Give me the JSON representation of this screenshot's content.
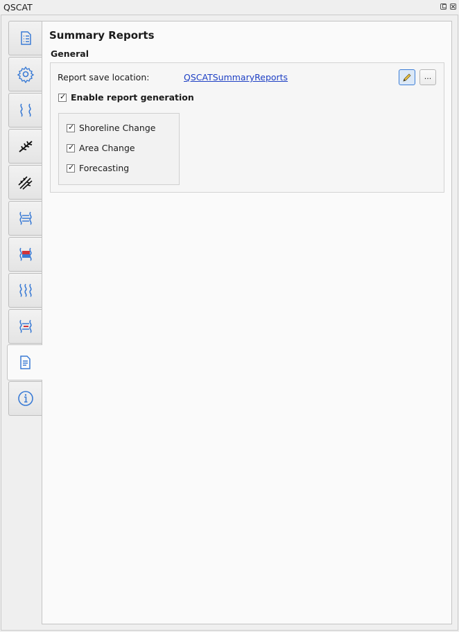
{
  "window": {
    "title": "QSCAT"
  },
  "tabs": [
    {
      "name": "project-settings",
      "icon": "list-document-icon"
    },
    {
      "name": "settings",
      "icon": "gear-icon"
    },
    {
      "name": "shorelines",
      "icon": "shoreline-lines-icon"
    },
    {
      "name": "transects",
      "icon": "transects-icon"
    },
    {
      "name": "intersections",
      "icon": "multi-transects-icon"
    },
    {
      "name": "shoreline-change",
      "icon": "shoreline-change-icon"
    },
    {
      "name": "area-change",
      "icon": "area-change-icon"
    },
    {
      "name": "forecasting",
      "icon": "forecasting-icon"
    },
    {
      "name": "visualization",
      "icon": "visualization-icon"
    },
    {
      "name": "summary-reports",
      "icon": "report-document-icon",
      "active": true
    },
    {
      "name": "about",
      "icon": "info-icon"
    }
  ],
  "page": {
    "title": "Summary Reports",
    "group_title": "General",
    "report_location_label": "Report save location:",
    "report_location_value": "QSCATSummaryReports",
    "browse_label": "...",
    "enable_label": "Enable report generation",
    "options": [
      {
        "label": "Shoreline Change",
        "checked": true
      },
      {
        "label": "Area Change",
        "checked": true
      },
      {
        "label": "Forecasting",
        "checked": true
      }
    ]
  },
  "colors": {
    "accent_blue": "#3a7bd5",
    "accent_red": "#d0343a",
    "link": "#1d3fc4"
  }
}
